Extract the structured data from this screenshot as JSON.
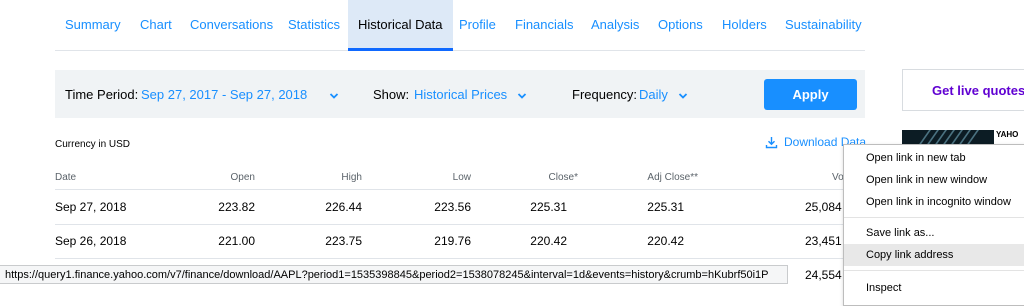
{
  "tabs": [
    "Summary",
    "Chart",
    "Conversations",
    "Statistics",
    "Historical Data",
    "Profile",
    "Financials",
    "Analysis",
    "Options",
    "Holders",
    "Sustainability"
  ],
  "active_tab": "Historical Data",
  "filters": {
    "time_period_label": "Time Period:",
    "time_period_value": "Sep 27, 2017 - Sep 27, 2018",
    "show_label": "Show:",
    "show_value": "Historical Prices",
    "frequency_label": "Frequency:",
    "frequency_value": "Daily",
    "apply_label": "Apply"
  },
  "promo": {
    "text": "Get live quotes a"
  },
  "ad": {
    "logo_text": "YAHO"
  },
  "currency_note": "Currency in USD",
  "download_label": "Download Data",
  "table": {
    "headers": [
      "Date",
      "Open",
      "High",
      "Low",
      "Close*",
      "Adj Close**",
      "Vo"
    ],
    "rows": [
      [
        "Sep 27, 2018",
        "223.82",
        "226.44",
        "223.56",
        "225.31",
        "225.31",
        "25,084"
      ],
      [
        "Sep 26, 2018",
        "221.00",
        "223.75",
        "219.76",
        "220.42",
        "220.42",
        "23,451"
      ],
      [
        "",
        "",
        "",
        "",
        "",
        "",
        "24,554"
      ]
    ]
  },
  "context_menu": {
    "items": [
      "Open link in new tab",
      "Open link in new window",
      "Open link in incognito window",
      "Save link as...",
      "Copy link address",
      "Inspect"
    ],
    "highlighted": "Copy link address"
  },
  "status_url": "https://query1.finance.yahoo.com/v7/finance/download/AAPL?period1=1535398845&period2=1538078245&interval=1d&events=history&crumb=hKubrf50i1P",
  "colors": {
    "link_blue": "#188fff",
    "apply_bg": "#188fff",
    "promo_purple": "#6001d2",
    "active_tab_bg": "#dde9f7"
  }
}
